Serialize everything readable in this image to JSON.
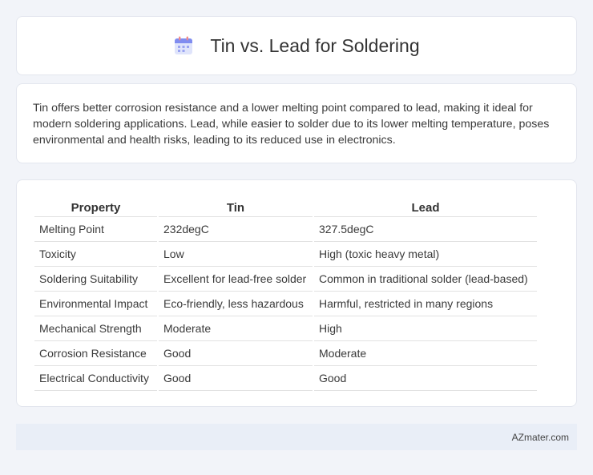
{
  "header": {
    "title": "Tin vs. Lead for Soldering",
    "icon": "calendar-icon"
  },
  "intro": {
    "text": "Tin offers better corrosion resistance and a lower melting point compared to lead, making it ideal for modern soldering applications. Lead, while easier to solder due to its lower melting temperature, poses environmental and health risks, leading to its reduced use in electronics."
  },
  "table": {
    "headers": [
      "Property",
      "Tin",
      "Lead"
    ],
    "rows": [
      [
        "Melting Point",
        "232degC",
        "327.5degC"
      ],
      [
        "Toxicity",
        "Low",
        "High (toxic heavy metal)"
      ],
      [
        "Soldering Suitability",
        "Excellent for lead-free solder",
        "Common in traditional solder (lead-based)"
      ],
      [
        "Environmental Impact",
        "Eco-friendly, less hazardous",
        "Harmful, restricted in many regions"
      ],
      [
        "Mechanical Strength",
        "Moderate",
        "High"
      ],
      [
        "Corrosion Resistance",
        "Good",
        "Moderate"
      ],
      [
        "Electrical Conductivity",
        "Good",
        "Good"
      ]
    ]
  },
  "footer": {
    "brand": "AZmater.com"
  }
}
